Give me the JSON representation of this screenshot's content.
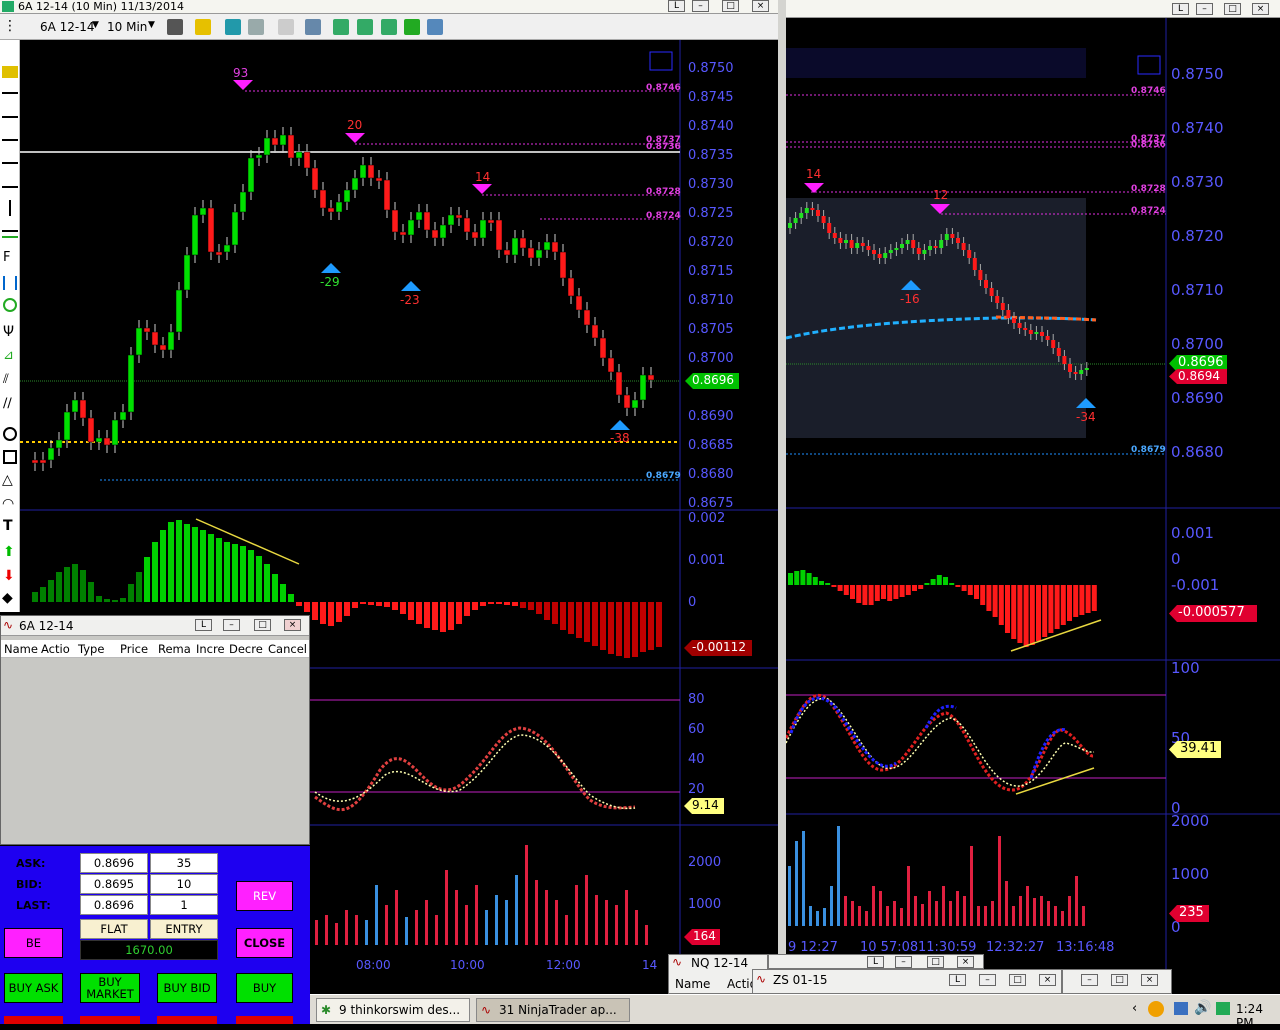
{
  "chart1": {
    "title": "6A 12-14 (10 Min)  11/13/2014",
    "toolbar": {
      "instrument": "6A 12-14",
      "interval": "10 Min"
    },
    "price_axis": [
      "0.8750",
      "0.8745",
      "0.8740",
      "0.8735",
      "0.8730",
      "0.8725",
      "0.8720",
      "0.8715",
      "0.8710",
      "0.8705",
      "0.8700",
      "0.8690",
      "0.8685",
      "0.8680",
      "0.8675"
    ],
    "level_labels": [
      "0.8746",
      "0.8737",
      "0.8736",
      "0.8728",
      "0.8724",
      "0.8679"
    ],
    "price_tag": "0.8696",
    "swing_labels": {
      "top1": "93",
      "top2": "20",
      "top3": "14",
      "bot1": "-29",
      "bot2": "-23",
      "bot3": "-38"
    },
    "macd_axis": [
      "0.002",
      "0.001",
      "0"
    ],
    "macd_tag": "-0.00112",
    "osc_axis": [
      "80",
      "60",
      "40",
      "20"
    ],
    "osc_tag": "9.14",
    "vol_axis": [
      "2000",
      "1000"
    ],
    "vol_tag": "164",
    "time_axis": [
      "08:00",
      "10:00",
      "12:00",
      "14"
    ]
  },
  "chart2": {
    "price_axis": [
      "0.8750",
      "0.8740",
      "0.8730",
      "0.8720",
      "0.8710",
      "0.8700",
      "0.8690",
      "0.8680"
    ],
    "level_labels": [
      "0.8746",
      "0.8737",
      "0.8736",
      "0.8728",
      "0.8724",
      "0.8679"
    ],
    "price_tag": "0.8696",
    "price_tag2": "0.8694",
    "swing_labels": {
      "top1": "14",
      "top2": "12",
      "bot1": "-16",
      "bot2": "-34"
    },
    "macd_axis": [
      "0.001",
      "0",
      "-0.001"
    ],
    "macd_tag": "-0.000577",
    "osc_axis": [
      "100",
      "50",
      "0"
    ],
    "osc_tag": "39.41",
    "vol_axis": [
      "2000",
      "1000",
      "0"
    ],
    "vol_tag": "235",
    "time_axis": [
      "9 12:27",
      "10 57:08",
      "11:30:59",
      "12:32:27",
      "13:16:48"
    ]
  },
  "orders": {
    "title": "6A 12-14",
    "columns": [
      "Name",
      "Actio",
      "Type",
      "Price",
      "Rema",
      "Incre",
      "Decre",
      "Cancel"
    ]
  },
  "trade": {
    "ask_label": "ASK:",
    "ask_price": "0.8696",
    "ask_size": "35",
    "bid_label": "BID:",
    "bid_price": "0.8695",
    "bid_size": "10",
    "last_label": "LAST:",
    "last_price": "0.8696",
    "last_size": "1",
    "position": "FLAT",
    "entry_label": "ENTRY",
    "pnl": "1670.00",
    "buttons": {
      "be": "BE",
      "rev": "REV",
      "close": "CLOSE",
      "buy_ask": "BUY ASK",
      "buy_market": "BUY MARKET",
      "buy_bid": "BUY BID",
      "buy": "BUY"
    }
  },
  "nq_window": {
    "title": "NQ 12-14",
    "col1": "Name",
    "col2": "Actio"
  },
  "zs_window": {
    "title": "ZS 01-15"
  },
  "taskbar": {
    "task1": "9 thinkorswim des...",
    "task2": "31 NinjaTrader ap...",
    "clock": "1:24 PM"
  }
}
